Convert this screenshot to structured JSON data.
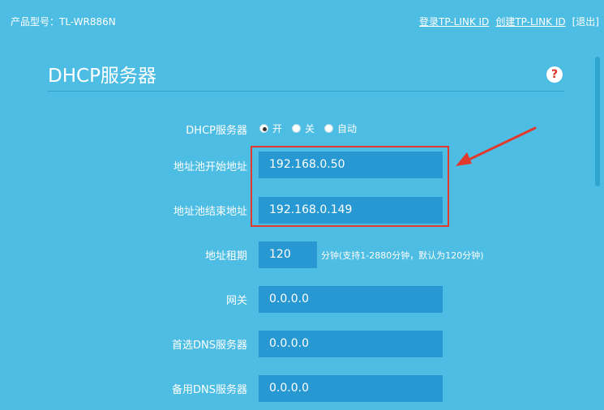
{
  "header": {
    "model_label": "产品型号：TL-WR886N",
    "login_link": "登录TP-LINK ID",
    "create_link": "创建TP-LINK ID",
    "logout_link": "[退出]"
  },
  "page": {
    "title": "DHCP服务器",
    "help_symbol": "?"
  },
  "form": {
    "dhcp_server": {
      "label": "DHCP服务器",
      "options": [
        "开",
        "关",
        "自动"
      ],
      "selected": "开"
    },
    "pool_start": {
      "label": "地址池开始地址",
      "value": "192.168.0.50"
    },
    "pool_end": {
      "label": "地址池结束地址",
      "value": "192.168.0.149"
    },
    "lease": {
      "label": "地址租期",
      "value": "120",
      "hint": "分钟(支持1-2880分钟，默认为120分钟)"
    },
    "gateway": {
      "label": "网关",
      "value": "0.0.0.0"
    },
    "primary_dns": {
      "label": "首选DNS服务器",
      "value": "0.0.0.0"
    },
    "secondary_dns": {
      "label": "备用DNS服务器",
      "value": "0.0.0.0"
    }
  },
  "colors": {
    "background": "#4dbde3",
    "field": "#2898d3",
    "annotation": "#e03a2e"
  }
}
